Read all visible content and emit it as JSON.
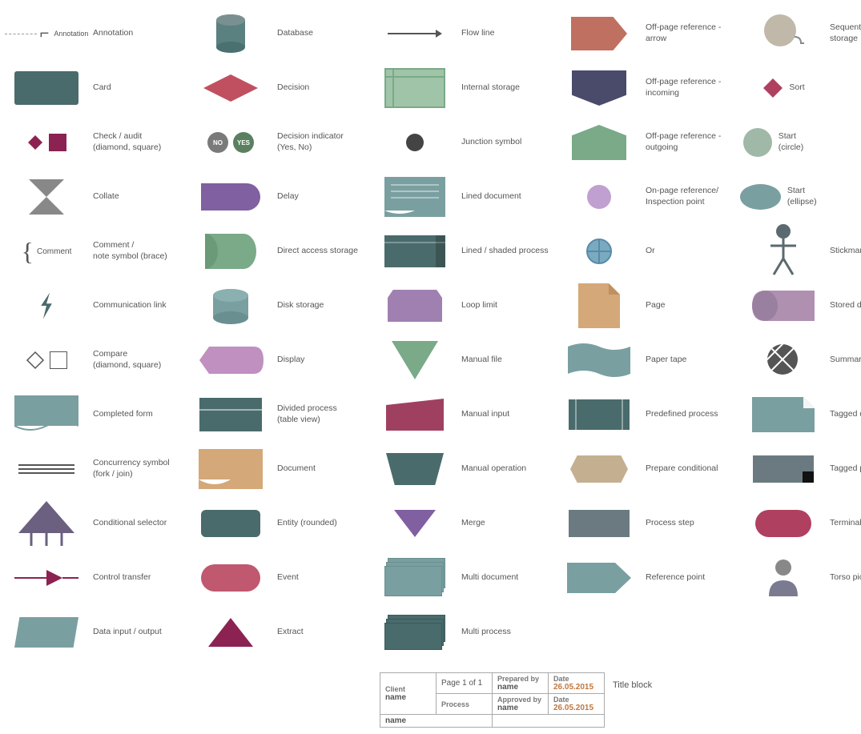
{
  "shapes": {
    "col1": [
      {
        "id": "annotation",
        "label": "Annotation"
      },
      {
        "id": "card",
        "label": "Card"
      },
      {
        "id": "check-audit",
        "label": "Check / audit\n(diamond, square)"
      },
      {
        "id": "collate",
        "label": "Collate"
      },
      {
        "id": "comment",
        "label": "Comment /\nnote symbol (brace)"
      },
      {
        "id": "comm-link",
        "label": "Communication link"
      },
      {
        "id": "compare",
        "label": "Compare\n(diamond, square)"
      },
      {
        "id": "completed-form",
        "label": "Completed form"
      },
      {
        "id": "concurrency",
        "label": "Concurrency symbol\n(fork / join)"
      },
      {
        "id": "conditional",
        "label": "Conditional selector"
      },
      {
        "id": "ctrl-transfer",
        "label": "Control transfer"
      },
      {
        "id": "data-io",
        "label": "Data input / output"
      }
    ],
    "col2": [
      {
        "id": "database",
        "label": "Database"
      },
      {
        "id": "decision",
        "label": "Decision"
      },
      {
        "id": "decision-indicator",
        "label": "Decision indicator\n(Yes, No)"
      },
      {
        "id": "delay",
        "label": "Delay"
      },
      {
        "id": "direct-access",
        "label": "Direct access storage"
      },
      {
        "id": "disk",
        "label": "Disk storage"
      },
      {
        "id": "display",
        "label": "Display"
      },
      {
        "id": "divided",
        "label": "Divided process\n(table view)"
      },
      {
        "id": "document",
        "label": "Document"
      },
      {
        "id": "entity",
        "label": "Entity (rounded)"
      },
      {
        "id": "event",
        "label": "Event"
      },
      {
        "id": "extract",
        "label": "Extract"
      }
    ],
    "col3": [
      {
        "id": "flowline",
        "label": "Flow line"
      },
      {
        "id": "internal",
        "label": "Internal storage"
      },
      {
        "id": "junction",
        "label": "Junction symbol"
      },
      {
        "id": "lined-doc",
        "label": "Lined document"
      },
      {
        "id": "lined-shaded",
        "label": "Lined / shaded process"
      },
      {
        "id": "loop-limit",
        "label": "Loop limit"
      },
      {
        "id": "manual-file",
        "label": "Manual file"
      },
      {
        "id": "manual-input",
        "label": "Manual input"
      },
      {
        "id": "manual-op",
        "label": "Manual operation"
      },
      {
        "id": "merge",
        "label": "Merge"
      },
      {
        "id": "multi-doc",
        "label": "Multi document"
      },
      {
        "id": "multi-process",
        "label": "Multi process"
      }
    ],
    "col4": [
      {
        "id": "offpage-arrow",
        "label": "Off-page reference -\narrow"
      },
      {
        "id": "offpage-incoming",
        "label": "Off-page reference -\nincoming"
      },
      {
        "id": "offpage-outgoing",
        "label": "Off-page reference -\noutgoing"
      },
      {
        "id": "onpage-ref",
        "label": "On-page reference/\nInspection point"
      },
      {
        "id": "or",
        "label": "Or"
      },
      {
        "id": "page",
        "label": "Page"
      },
      {
        "id": "paper-tape",
        "label": "Paper tape"
      },
      {
        "id": "predefined",
        "label": "Predefined process"
      },
      {
        "id": "prepare",
        "label": "Prepare conditional"
      },
      {
        "id": "process-step",
        "label": "Process step"
      },
      {
        "id": "ref-point",
        "label": "Reference point"
      }
    ],
    "col5": [
      {
        "id": "seq-access",
        "label": "Sequential access\nstorage"
      },
      {
        "id": "sort",
        "label": "Sort"
      },
      {
        "id": "start-circle",
        "label": "Start (circle)"
      },
      {
        "id": "start-ellipse",
        "label": "Start (ellipse)"
      },
      {
        "id": "stickman",
        "label": "Stickman pictogram"
      },
      {
        "id": "stored-data",
        "label": "Stored data"
      },
      {
        "id": "summary",
        "label": "Summary"
      },
      {
        "id": "tagged-doc",
        "label": "Tagged document"
      },
      {
        "id": "tagged-process",
        "label": "Tagged process"
      },
      {
        "id": "terminal",
        "label": "Terminal point"
      },
      {
        "id": "torso",
        "label": "Torso pictogram"
      }
    ]
  },
  "titleblock": {
    "client_label": "Client",
    "client_name": "name",
    "page_label": "Page 1 of 1",
    "prepared_by_label": "Prepared by",
    "prepared_by_name": "name",
    "date_label": "Date",
    "date_value": "26.05.2015",
    "process_label": "Process",
    "process_name": "name",
    "approved_by_label": "Approved by",
    "approved_by_name": "name",
    "date2_label": "Date",
    "date2_value": "26.05.2015",
    "title": "Title block"
  },
  "decision_indicator": {
    "no": "NO",
    "yes": "YES"
  }
}
